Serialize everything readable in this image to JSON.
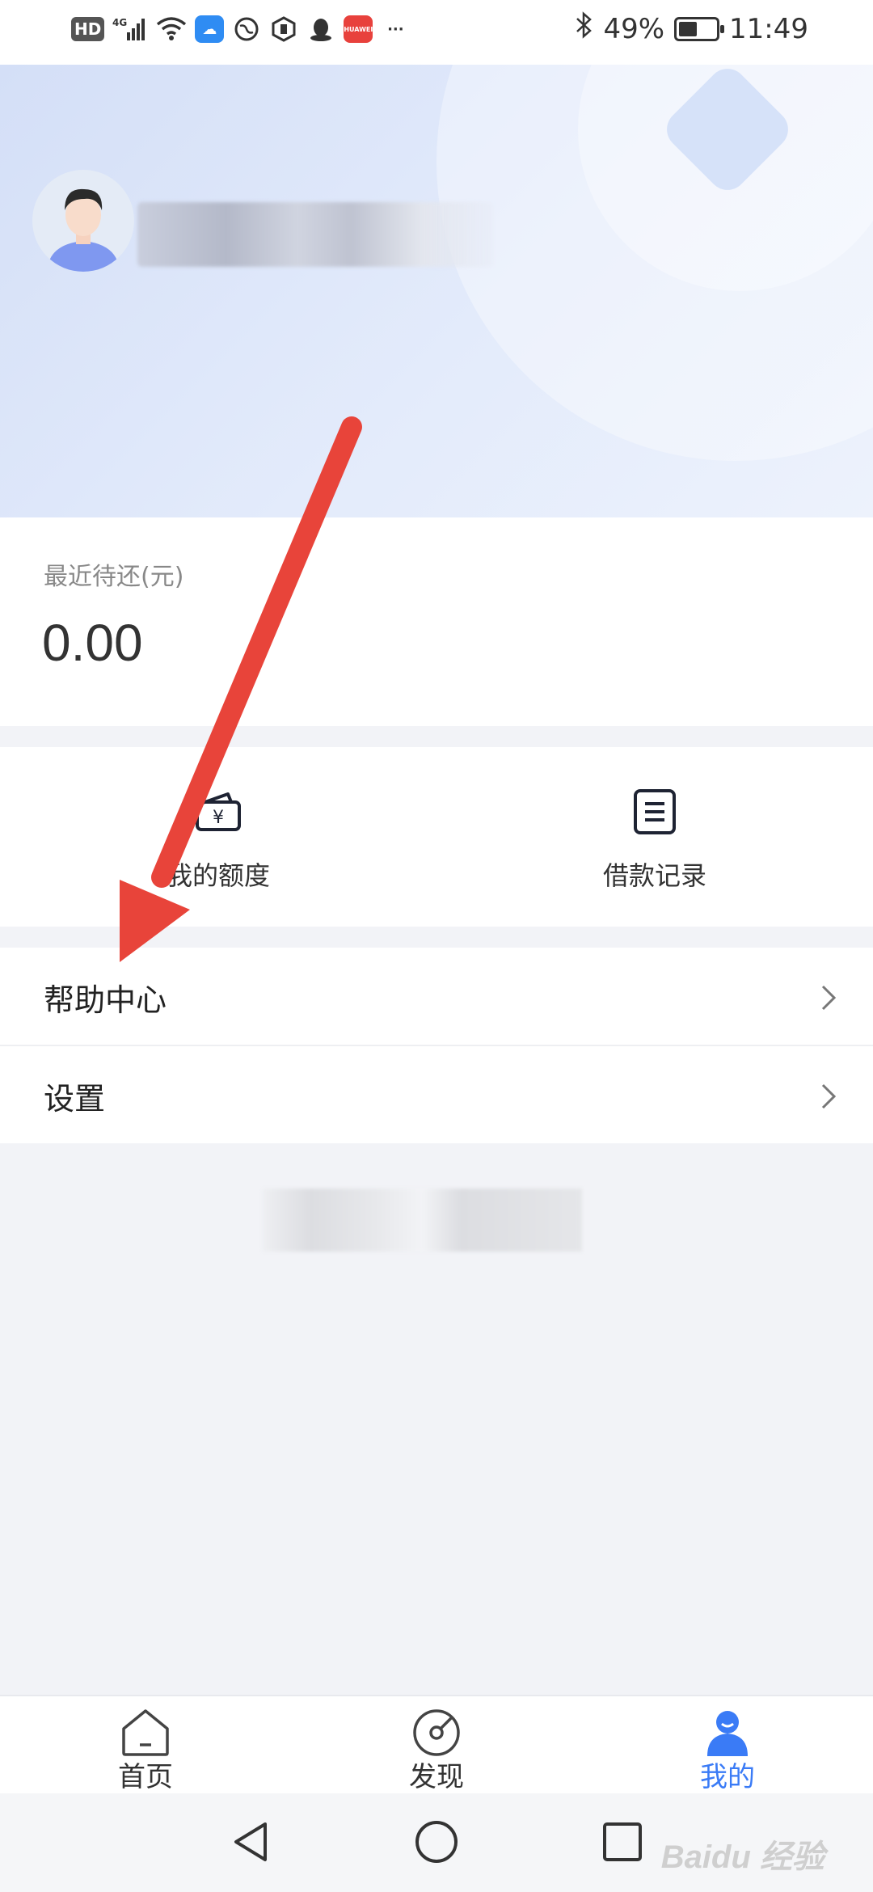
{
  "status_bar": {
    "network_hd": "HD",
    "network_type": "4G",
    "battery_percent": "49%",
    "battery_level": 0.49,
    "time": "11:49",
    "more": "···"
  },
  "profile": {
    "username_redacted": ""
  },
  "repay": {
    "label": "最近待还(元)",
    "amount": "0.00"
  },
  "shortcuts": [
    {
      "label": "我的额度",
      "icon": "wallet-yen-icon"
    },
    {
      "label": "借款记录",
      "icon": "record-list-icon"
    }
  ],
  "menu": [
    {
      "label": "帮助中心",
      "icon": "chevron-right-icon"
    },
    {
      "label": "设置",
      "icon": "chevron-right-icon"
    }
  ],
  "tabbar": [
    {
      "label": "首页",
      "icon": "home-icon",
      "active": false
    },
    {
      "label": "发现",
      "icon": "discover-icon",
      "active": false
    },
    {
      "label": "我的",
      "icon": "user-icon",
      "active": true
    }
  ],
  "watermark": "Baidu 经验",
  "colors": {
    "accent": "#3a7bf6",
    "arrow": "#e8443a",
    "header_bg": "#dde6f8"
  }
}
